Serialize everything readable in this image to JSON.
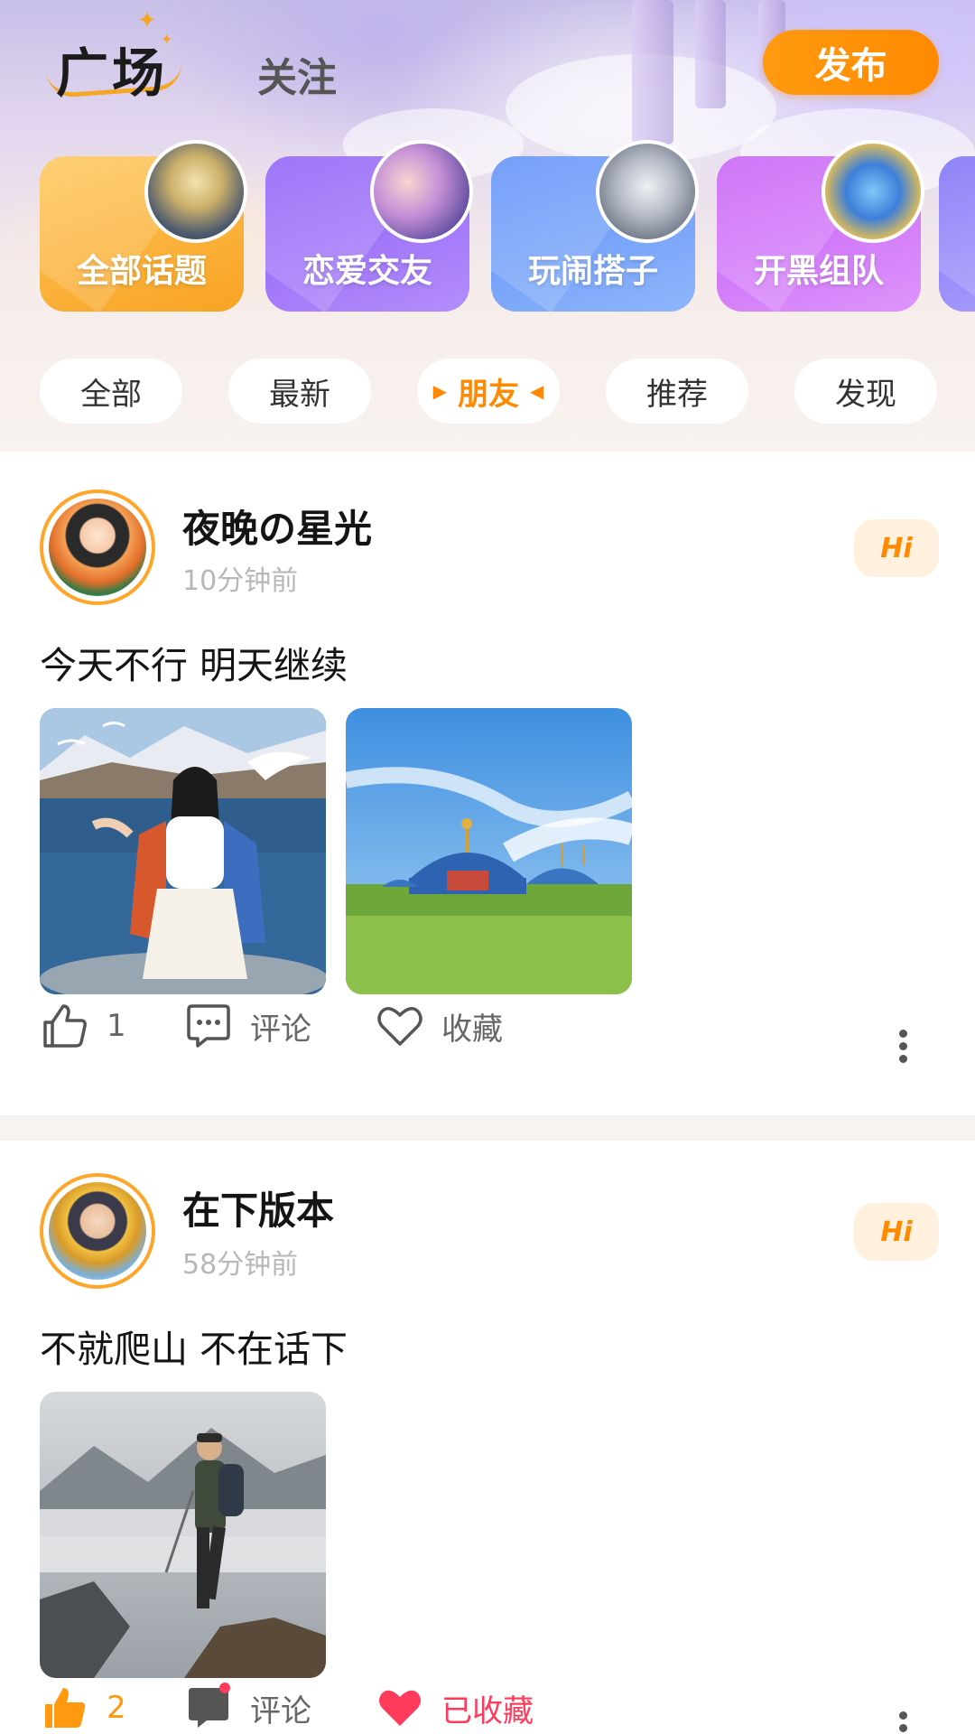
{
  "header": {
    "tab_active": "广场",
    "tab_follow": "关注",
    "publish_label": "发布"
  },
  "topics": [
    {
      "label": "全部话题",
      "icon": "fantasy-knight-icon"
    },
    {
      "label": "恋爱交友",
      "icon": "couple-icon"
    },
    {
      "label": "玩闹搭子",
      "icon": "hero-duo-icon"
    },
    {
      "label": "开黑组队",
      "icon": "penguin-mascot-icon"
    }
  ],
  "filters": [
    {
      "label": "全部",
      "active": false
    },
    {
      "label": "最新",
      "active": false
    },
    {
      "label": "朋友",
      "active": true
    },
    {
      "label": "推荐",
      "active": false
    },
    {
      "label": "发现",
      "active": false
    }
  ],
  "posts": [
    {
      "username": "夜晚の星光",
      "time": "10分钟前",
      "hi_label": "Hi",
      "text": "今天不行 明天继续",
      "likes": "1",
      "comment_label": "评论",
      "favorite_label": "收藏"
    },
    {
      "username": "在下版本",
      "time": "58分钟前",
      "hi_label": "Hi",
      "text": "不就爬山 不在话下",
      "likes": "2",
      "comment_label": "评论",
      "favorite_label": "已收藏"
    }
  ],
  "colors": {
    "accent": "#ff8a00",
    "liked": "#ff9a10",
    "favorited": "#ff3b5c"
  }
}
